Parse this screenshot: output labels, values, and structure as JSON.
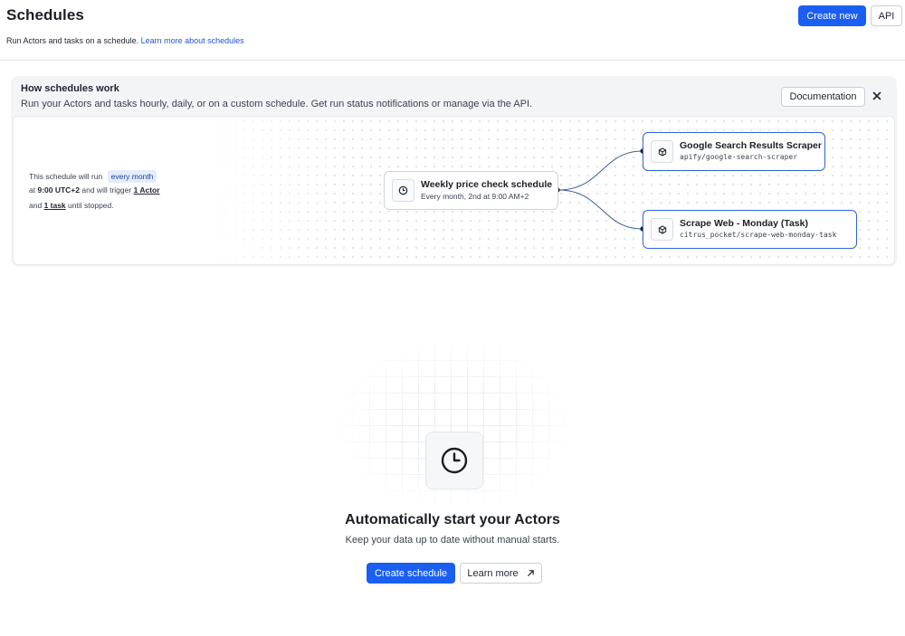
{
  "header": {
    "title": "Schedules",
    "subtitle_text": "Run Actors and tasks on a schedule.",
    "subtitle_link": "Learn more about schedules",
    "create_new_label": "Create new",
    "api_label": "API"
  },
  "banner": {
    "title": "How schedules work",
    "description": "Run your Actors and tasks hourly, daily, or on a custom schedule. Get run status notifications or manage via the API.",
    "documentation_label": "Documentation",
    "close_icon": "close-icon",
    "sentence": {
      "line1_prefix": "This schedule will run",
      "frequency": "every month",
      "line2_prefix": "at",
      "time": "9:00 UTC+2",
      "line2_middle": "and will trigger",
      "actor_count": "1 Actor",
      "line3_prefix": "and",
      "task_count": "1 task",
      "line3_suffix": "until stopped."
    },
    "schedule_node": {
      "name": "Weekly price check schedule",
      "detail": "Every month, 2nd at 9:00 AM+2",
      "icon": "clock-icon"
    },
    "targets": [
      {
        "name": "Google Search Results Scraper",
        "id": "apify/google-search-scraper",
        "icon": "cube-icon"
      },
      {
        "name": "Scrape Web - Monday (Task)",
        "id": "citrus_pocket/scrape-web-monday-task",
        "icon": "cube-icon"
      }
    ]
  },
  "empty_state": {
    "icon": "clock-icon",
    "title": "Automatically start your Actors",
    "description": "Keep your data up to date without manual starts.",
    "create_schedule_label": "Create schedule",
    "learn_more_label": "Learn more",
    "learn_more_icon": "external-arrow-icon"
  },
  "colors": {
    "primary": "#1b5ef2",
    "link": "#1e55d6",
    "node_border_active": "#2f64e0",
    "banner_bg": "#f3f4f6"
  }
}
